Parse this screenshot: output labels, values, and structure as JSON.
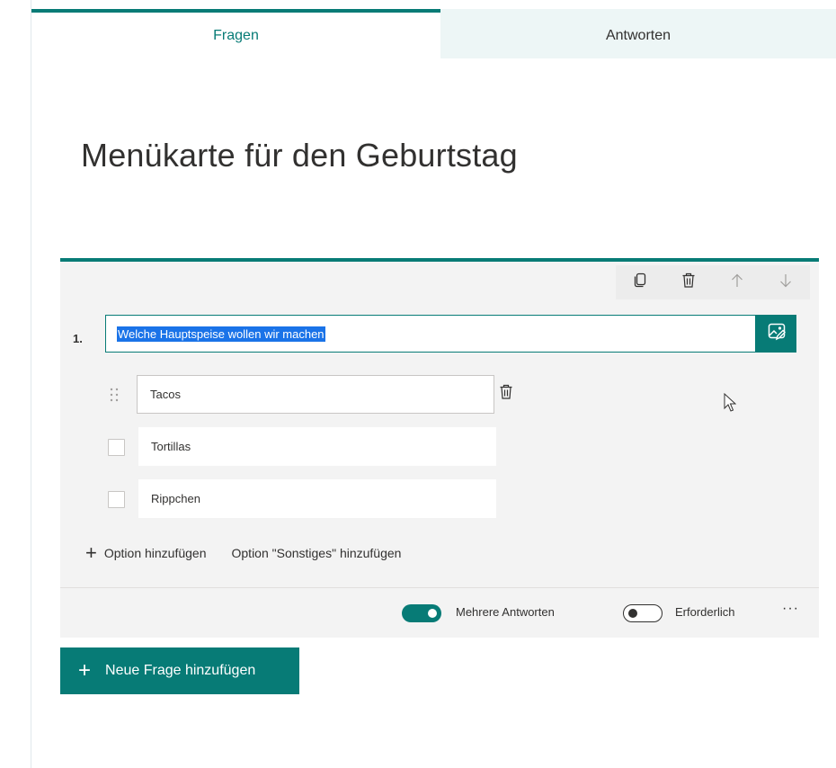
{
  "tabs": [
    {
      "label": "Fragen",
      "active": true
    },
    {
      "label": "Antworten",
      "active": false
    }
  ],
  "form": {
    "title": "Menükarte für den Geburtstag"
  },
  "question": {
    "number": "1.",
    "text": "Welche Hauptspeise wollen wir machen",
    "toolbar": {
      "icons": [
        "copy-icon",
        "trash-icon",
        "arrow-up-icon",
        "arrow-down-icon"
      ]
    },
    "options": [
      {
        "label": "Tacos",
        "editing": true
      },
      {
        "label": "Tortillas",
        "editing": false
      },
      {
        "label": "Rippchen",
        "editing": false
      }
    ],
    "add_option_label": "Option hinzufügen",
    "add_other_label": "Option \"Sonstiges\" hinzufügen",
    "footer": {
      "multiple_answers_label": "Mehrere Antworten",
      "multiple_answers_on": true,
      "required_label": "Erforderlich",
      "required_on": false,
      "more_label": "···"
    }
  },
  "new_question_label": "Neue Frage hinzufügen",
  "colors": {
    "accent": "#077b76",
    "tab_inactive_bg": "#edf6f6",
    "card_bg": "#f3f3f3",
    "selection": "#1a73e8"
  }
}
